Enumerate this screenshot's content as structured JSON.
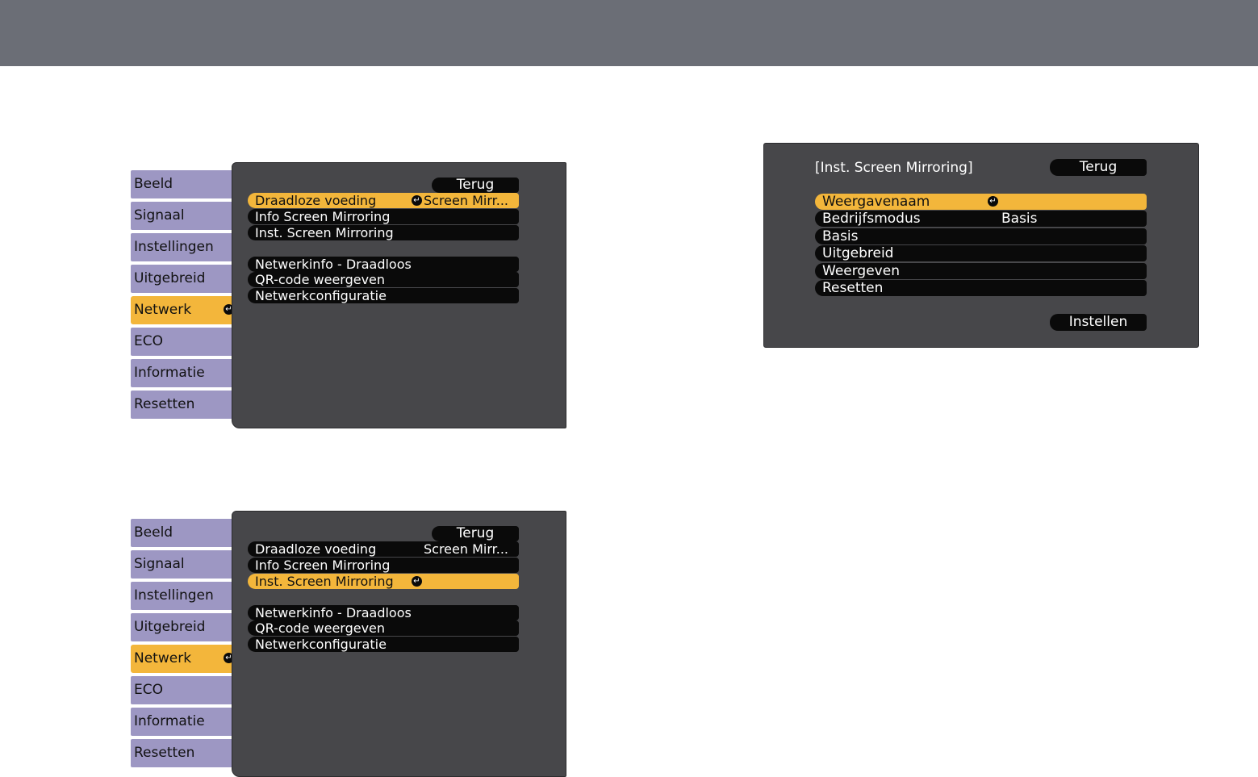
{
  "menu1": {
    "tabs": [
      "Beeld",
      "Signaal",
      "Instellingen",
      "Uitgebreid",
      "Netwerk",
      "ECO",
      "Informatie",
      "Resetten"
    ],
    "active_tab": "Netwerk",
    "back_label": "Terug",
    "items": [
      {
        "label": "Draadloze voeding",
        "value": "Screen Mirr...",
        "highlighted": true
      },
      {
        "label": "Info Screen Mirroring",
        "value": "",
        "highlighted": false
      },
      {
        "label": "Inst. Screen Mirroring",
        "value": "",
        "highlighted": false
      },
      {
        "label": "Netwerkinfo - Draadloos",
        "value": "",
        "highlighted": false
      },
      {
        "label": "QR-code weergeven",
        "value": "",
        "highlighted": false
      },
      {
        "label": "Netwerkconfiguratie",
        "value": "",
        "highlighted": false
      }
    ]
  },
  "menu2": {
    "tabs": [
      "Beeld",
      "Signaal",
      "Instellingen",
      "Uitgebreid",
      "Netwerk",
      "ECO",
      "Informatie",
      "Resetten"
    ],
    "active_tab": "Netwerk",
    "back_label": "Terug",
    "items": [
      {
        "label": "Draadloze voeding",
        "value": "Screen Mirr...",
        "highlighted": false
      },
      {
        "label": "Info Screen Mirroring",
        "value": "",
        "highlighted": false
      },
      {
        "label": "Inst. Screen Mirroring",
        "value": "",
        "highlighted": true
      },
      {
        "label": "Netwerkinfo - Draadloos",
        "value": "",
        "highlighted": false
      },
      {
        "label": "QR-code weergeven",
        "value": "",
        "highlighted": false
      },
      {
        "label": "Netwerkconfiguratie",
        "value": "",
        "highlighted": false
      }
    ]
  },
  "dialog": {
    "title": "[Inst. Screen Mirroring]",
    "back_label": "Terug",
    "set_label": "Instellen",
    "items": [
      {
        "label": "Weergavenaam",
        "value": "",
        "highlighted": true
      },
      {
        "label": "Bedrijfsmodus",
        "value": "Basis",
        "highlighted": false
      },
      {
        "label": "Basis",
        "value": "",
        "highlighted": false
      },
      {
        "label": "Uitgebreid",
        "value": "",
        "highlighted": false
      },
      {
        "label": "Weergeven",
        "value": "",
        "highlighted": false
      },
      {
        "label": "Resetten",
        "value": "",
        "highlighted": false
      }
    ]
  },
  "colors": {
    "header_bar": "#6b6e76",
    "panel": "#47474a",
    "tab": "#9d97c3",
    "highlight": "#f3b63b",
    "pill": "#0a0a0a"
  },
  "icons": {
    "enter": "enter-icon"
  }
}
